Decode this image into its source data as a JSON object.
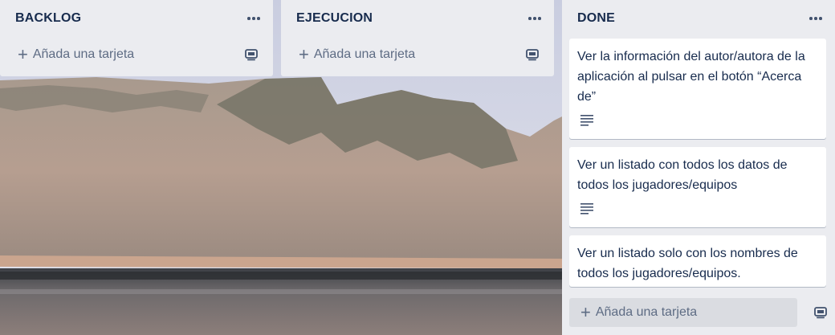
{
  "board": {
    "lists": [
      {
        "title": "BACKLOG",
        "add_label": "Añada una tarjeta"
      },
      {
        "title": "EJECUCION",
        "add_label": "Añada una tarjeta"
      },
      {
        "title": "DONE",
        "add_label": "Añada una tarjeta"
      }
    ],
    "done_cards": [
      {
        "text": "Ver la información del autor/autora de la aplicación al pulsar en el botón “Acerca de”",
        "has_description": true
      },
      {
        "text": "Ver un listado con todos los datos de todos los jugadores/equipos",
        "has_description": true
      },
      {
        "text": "Ver un listado solo con los nombres de todos los jugadores/equipos.",
        "has_description": false
      }
    ]
  },
  "icons": {
    "menu": "more-horizontal-icon",
    "add": "plus-icon",
    "template": "card-template-icon",
    "description": "description-icon"
  }
}
